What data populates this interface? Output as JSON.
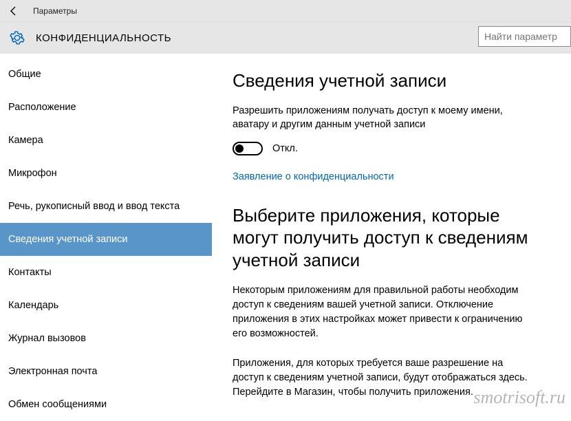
{
  "titlebar": {
    "title": "Параметры"
  },
  "header": {
    "title": "КОНФИДЕНЦИАЛЬНОСТЬ",
    "search_placeholder": "Найти параметр"
  },
  "sidebar": {
    "items": [
      {
        "label": "Общие"
      },
      {
        "label": "Расположение"
      },
      {
        "label": "Камера"
      },
      {
        "label": "Микрофон"
      },
      {
        "label": "Речь, рукописный ввод и ввод текста"
      },
      {
        "label": "Сведения учетной записи"
      },
      {
        "label": "Контакты"
      },
      {
        "label": "Календарь"
      },
      {
        "label": "Журнал вызовов"
      },
      {
        "label": "Электронная почта"
      },
      {
        "label": "Обмен сообщениями"
      }
    ],
    "selected_index": 5
  },
  "content": {
    "section_title": "Сведения учетной записи",
    "permission_desc": "Разрешить приложениям получать доступ к моему имени, аватару и другим данным учетной записи",
    "toggle_state": "off",
    "toggle_label": "Откл.",
    "privacy_link": "Заявление о конфиденциальности",
    "section_title2": "Выберите приложения, которые могут получить доступ к сведениям учетной записи",
    "para1": "Некоторым приложениям для правильной работы необходим доступ к сведениям вашей учетной записи. Отключение приложения в этих настройках может привести к ограничению его возможностей.",
    "para2": "Приложения, для которых требуется ваше разрешение на доступ к сведениям учетной записи, будут отображаться здесь. Перейдите в Магазин, чтобы получить приложения."
  },
  "watermark": "smotrisoft.ru"
}
